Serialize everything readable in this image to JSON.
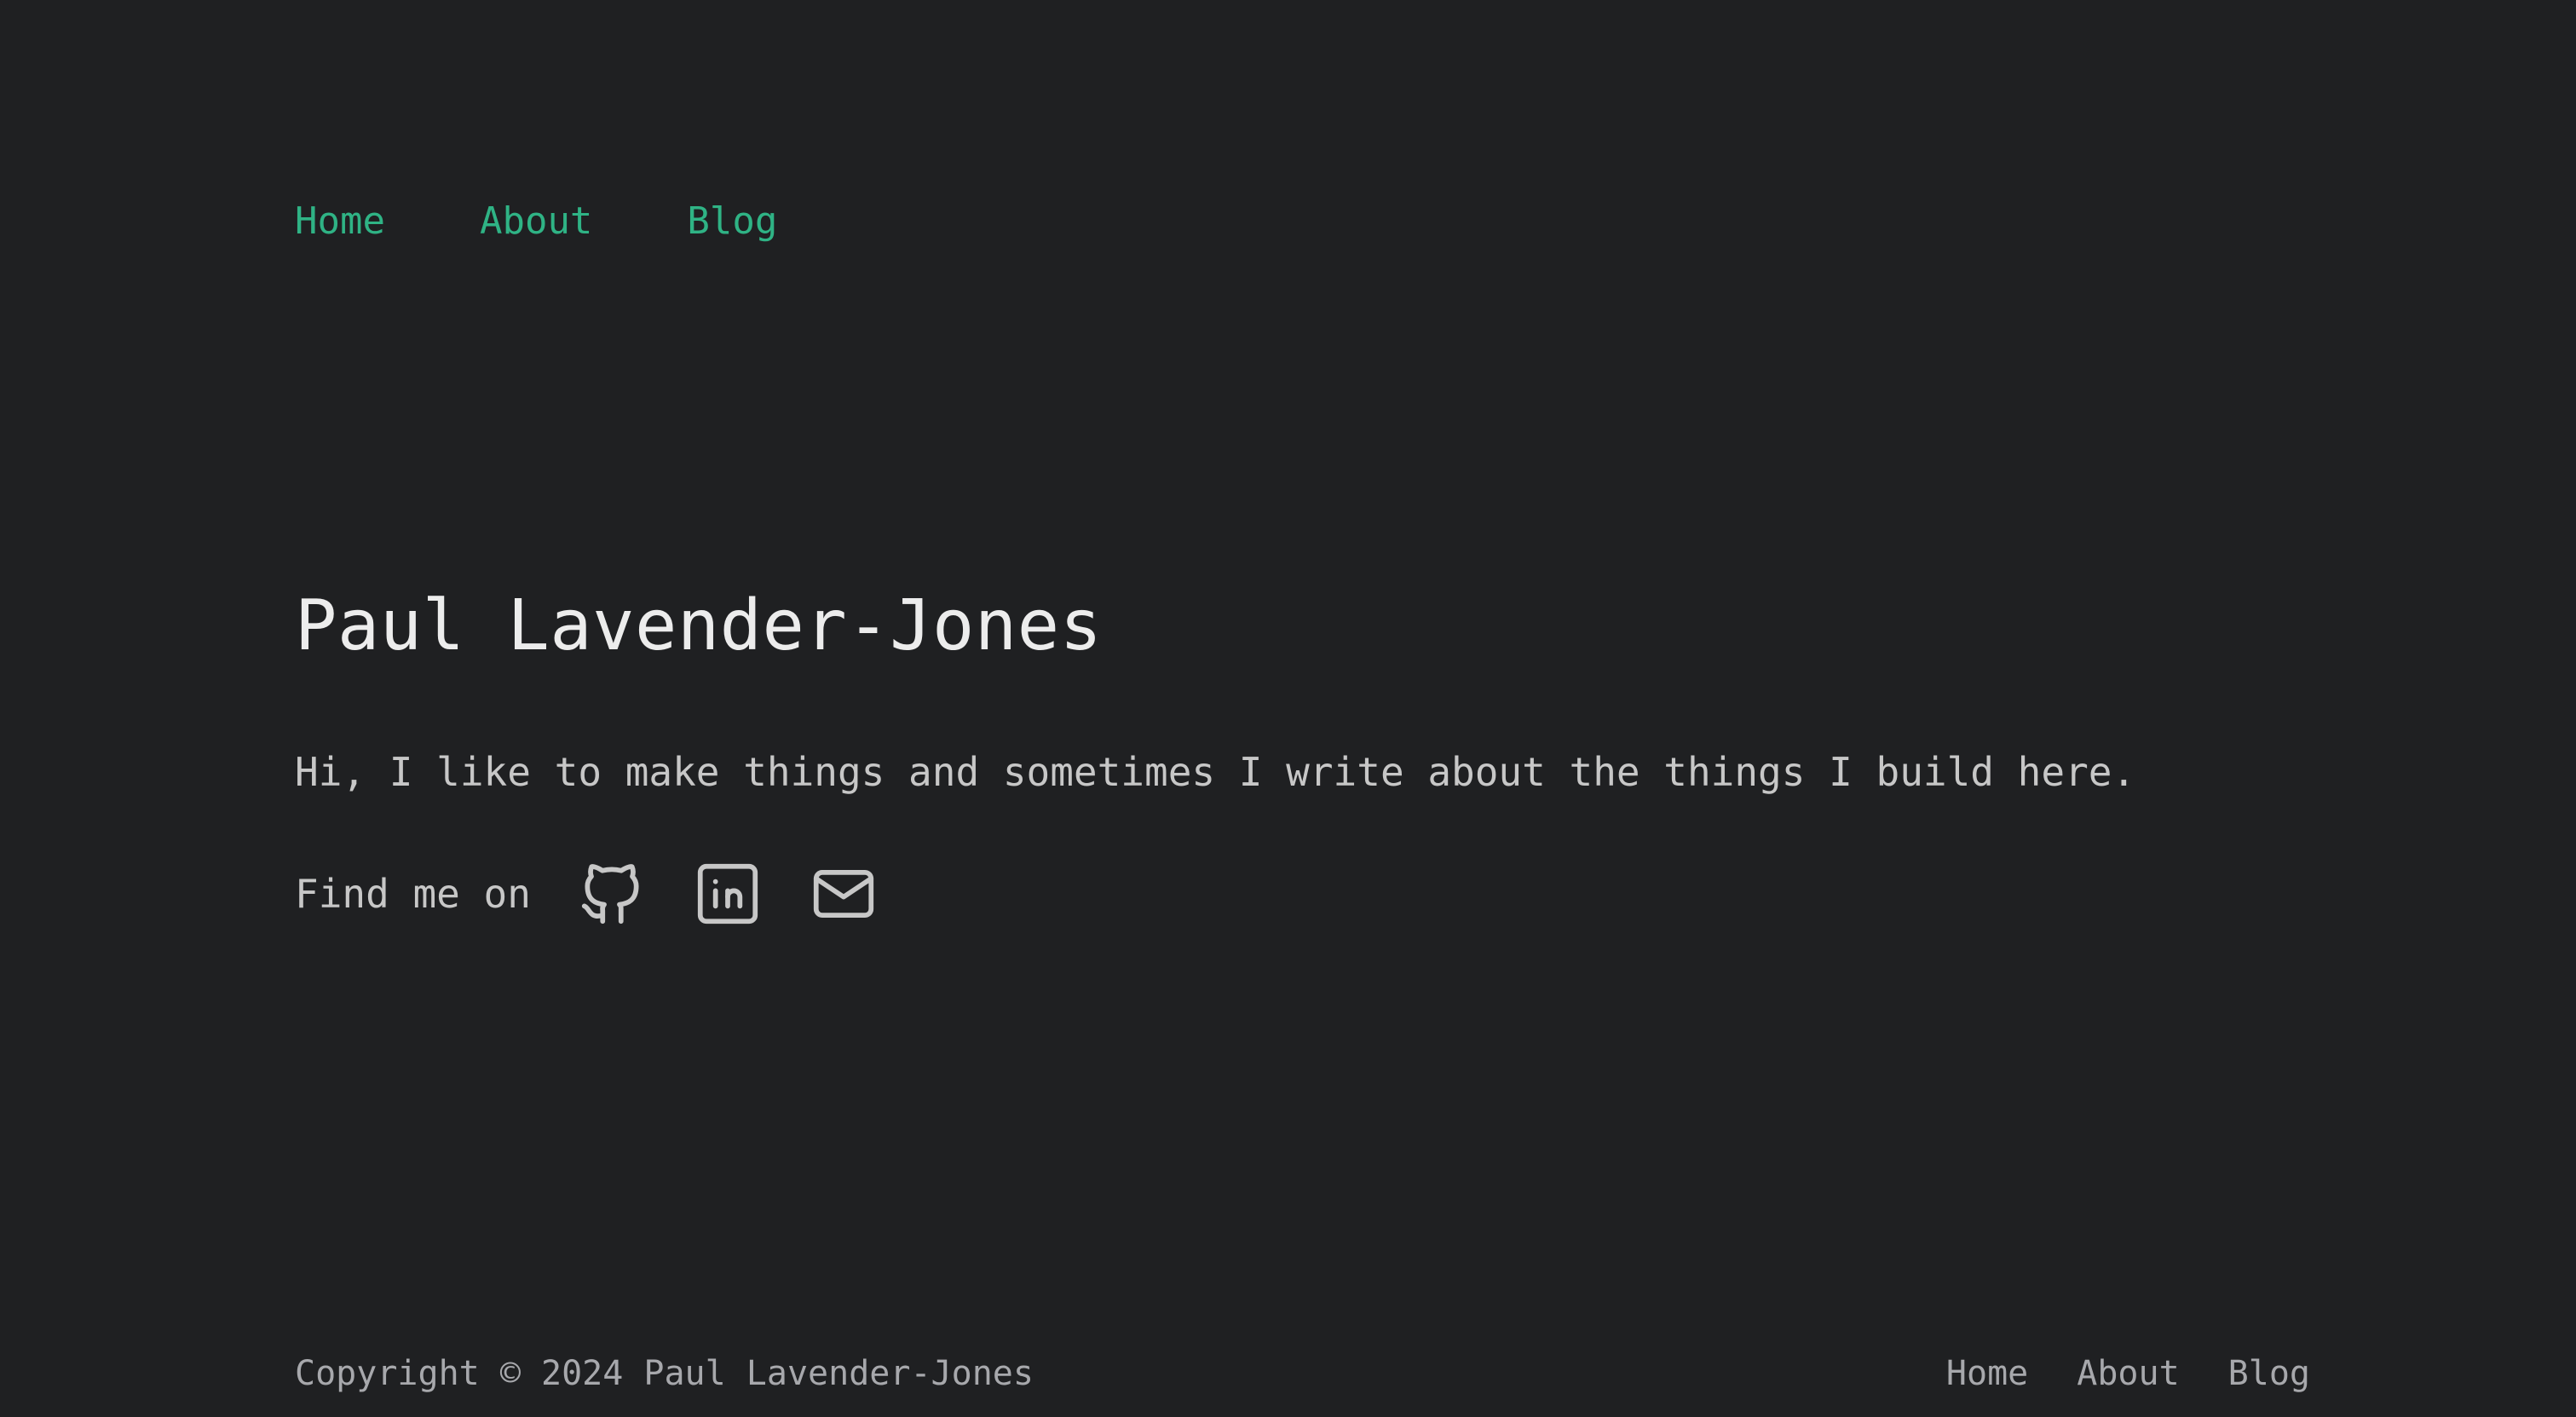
{
  "colors": {
    "background": "#1f2022",
    "nav_link": "#2fb385",
    "heading": "#ececec",
    "body_text": "#c7c7c7",
    "footer_text": "#a7a8ac"
  },
  "header": {
    "nav": [
      {
        "label": "Home"
      },
      {
        "label": "About"
      },
      {
        "label": "Blog"
      }
    ]
  },
  "main": {
    "title": "Paul Lavender-Jones",
    "intro": "Hi, I like to make things and sometimes I write about the things I build here.",
    "social": {
      "label": "Find me on",
      "links": [
        {
          "icon": "github-icon"
        },
        {
          "icon": "linkedin-icon"
        },
        {
          "icon": "mail-icon"
        }
      ]
    }
  },
  "footer": {
    "copyright": "Copyright © 2024 Paul Lavender-Jones",
    "nav": [
      {
        "label": "Home"
      },
      {
        "label": "About"
      },
      {
        "label": "Blog"
      }
    ]
  }
}
